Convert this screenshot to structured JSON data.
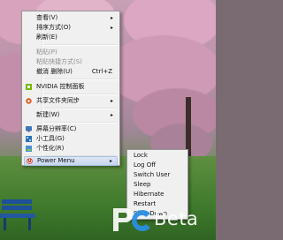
{
  "context_menu": {
    "items": [
      {
        "label": "查看(V)",
        "arrow": "▸",
        "disabled": false
      },
      {
        "label": "排序方式(O)",
        "arrow": "▸",
        "disabled": false
      },
      {
        "label": "刷新(E)",
        "arrow": "",
        "disabled": false
      },
      {
        "label": "粘贴(P)",
        "arrow": "",
        "disabled": true
      },
      {
        "label": "粘贴快捷方式(S)",
        "arrow": "",
        "disabled": true
      },
      {
        "label": "撤消 删除(U)",
        "shortcut": "Ctrl+Z",
        "arrow": "",
        "disabled": false
      },
      {
        "label": "NVIDIA 控制面板",
        "arrow": "",
        "disabled": false,
        "icon": "nvidia-icon"
      },
      {
        "label": "共享文件夹同步",
        "arrow": "▸",
        "disabled": false,
        "icon": "sync-icon"
      },
      {
        "label": "新建(W)",
        "arrow": "▸",
        "disabled": false
      },
      {
        "label": "屏幕分辨率(C)",
        "arrow": "",
        "disabled": false,
        "icon": "display-icon"
      },
      {
        "label": "小工具(G)",
        "arrow": "",
        "disabled": false,
        "icon": "gadgets-icon"
      },
      {
        "label": "个性化(R)",
        "arrow": "",
        "disabled": false,
        "icon": "personalize-icon"
      },
      {
        "label": "Power Menu",
        "arrow": "▸",
        "disabled": false,
        "icon": "power-icon",
        "highlighted": true
      }
    ]
  },
  "power_submenu": {
    "items": [
      {
        "label": "Lock"
      },
      {
        "label": "Log Off"
      },
      {
        "label": "Switch User"
      },
      {
        "label": "Sleep"
      },
      {
        "label": "Hibernate"
      },
      {
        "label": "Restart"
      },
      {
        "label": "Shut Down"
      }
    ]
  },
  "watermark": {
    "text": "Beta"
  },
  "colors": {
    "menu_bg": "#f0f0f0",
    "menu_border": "#979797",
    "highlight": "#c6d6ee",
    "disabled_text": "#8d8d8d"
  }
}
